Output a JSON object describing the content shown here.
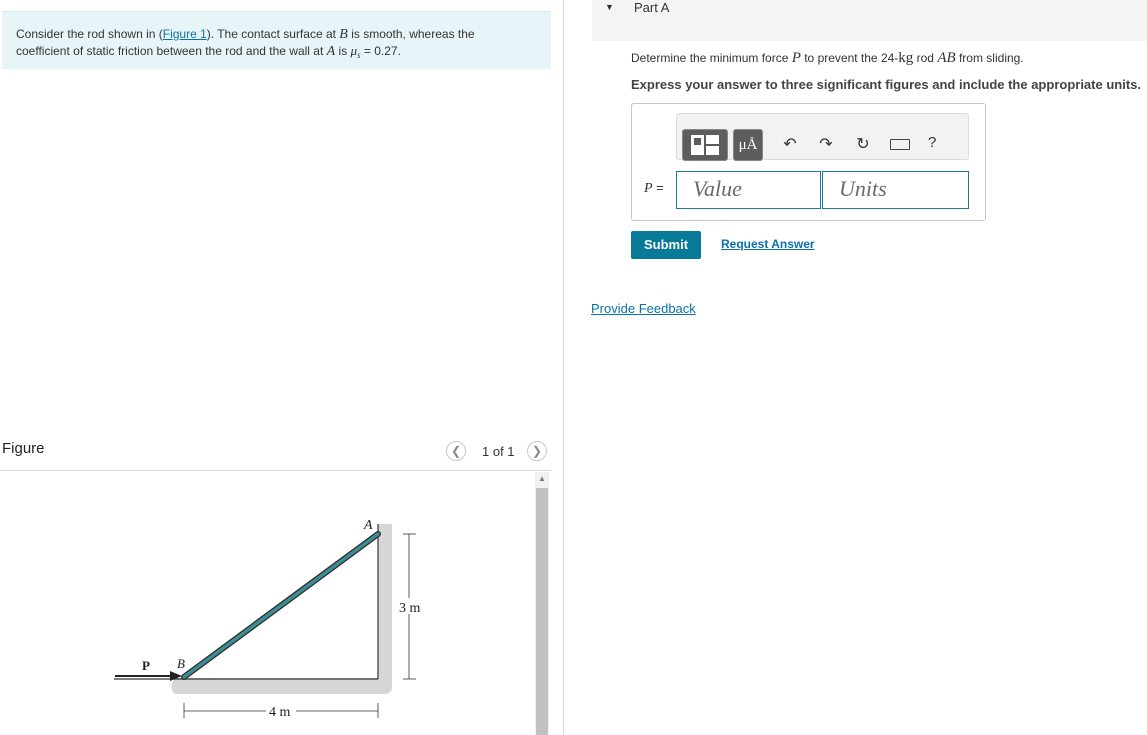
{
  "intro": {
    "text_1": "Consider the rod shown in (",
    "figure_link": "Figure 1",
    "text_2": "). The contact surface at ",
    "var_b": "B",
    "text_3": " is smooth, whereas the",
    "text_4": "coefficient of static friction between the rod and the wall at ",
    "var_a": "A",
    "text_5": " is ",
    "mu": "μ",
    "mu_sub": "s",
    "text_6": " = 0.27."
  },
  "figure": {
    "title": "Figure",
    "pager": "1 of 1",
    "prev_icon": "chevron-left-icon",
    "next_icon": "chevron-right-icon",
    "labels": {
      "a": "A",
      "b": "B",
      "p": "P",
      "height": "3 m",
      "width": "4 m"
    }
  },
  "part": {
    "title": "Part A",
    "question_1": "Determine the minimum force ",
    "question_var_p": "P",
    "question_2": " to prevent the 24-",
    "question_unit": "kg",
    "question_3": " rod ",
    "question_var_ab": "AB",
    "question_4": " from sliding.",
    "instruction": "Express your answer to three significant figures and include the appropriate units."
  },
  "answer": {
    "p_label_var": "P",
    "p_label_eq": " =",
    "value_placeholder": "Value",
    "units_placeholder": "Units",
    "units_button": "μÅ",
    "help": "?",
    "icons": [
      "templates-icon",
      "units-icon",
      "undo-icon",
      "redo-icon",
      "reset-icon",
      "keyboard-icon",
      "help-icon"
    ]
  },
  "actions": {
    "submit": "Submit",
    "request_answer": "Request Answer",
    "feedback": "Provide Feedback"
  }
}
